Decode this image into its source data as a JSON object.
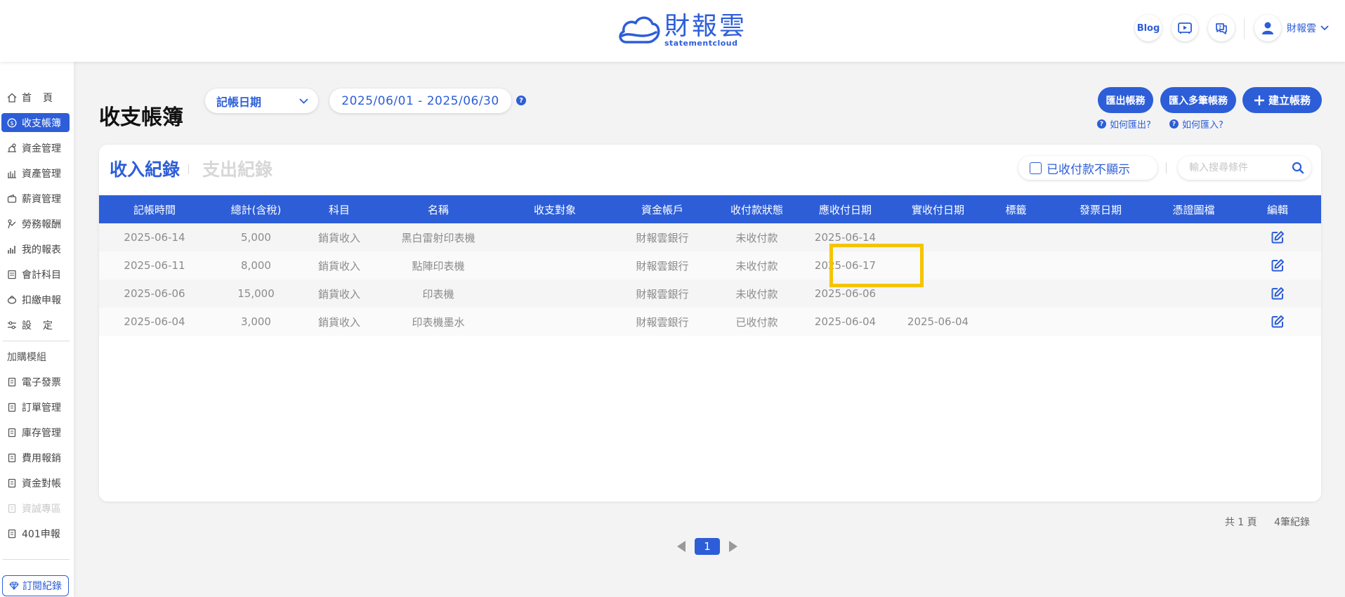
{
  "header": {
    "logo_cn": "財報雲",
    "logo_en": "statementcloud",
    "blog_label": "Blog",
    "user_name": "財報雲"
  },
  "sidebar": {
    "items": [
      {
        "label": "首頁",
        "icon": "home-icon",
        "active": false
      },
      {
        "label": "收支帳簿",
        "icon": "money-circle-icon",
        "active": true
      },
      {
        "label": "資金管理",
        "icon": "fund-icon",
        "active": false
      },
      {
        "label": "資產管理",
        "icon": "asset-icon",
        "active": false
      },
      {
        "label": "薪資管理",
        "icon": "wallet-icon",
        "active": false
      },
      {
        "label": "勞務報酬",
        "icon": "labor-icon",
        "active": false
      },
      {
        "label": "我的報表",
        "icon": "bar-chart-icon",
        "active": false
      },
      {
        "label": "會計科目",
        "icon": "ledger-icon",
        "active": false
      },
      {
        "label": "扣繳申報",
        "icon": "tax-icon",
        "active": false
      },
      {
        "label": "設定",
        "icon": "settings-sliders-icon",
        "active": false
      }
    ],
    "addon_title": "加購模組",
    "addons": [
      {
        "label": "電子發票",
        "disabled": false
      },
      {
        "label": "訂單管理",
        "disabled": false
      },
      {
        "label": "庫存管理",
        "disabled": false
      },
      {
        "label": "費用報銷",
        "disabled": false
      },
      {
        "label": "資金對帳",
        "disabled": false
      },
      {
        "label": "資誠專區",
        "disabled": true
      },
      {
        "label": "401申報",
        "disabled": false
      }
    ],
    "subscription_label": "訂閱紀錄"
  },
  "page": {
    "title": "收支帳簿",
    "date_type": "記帳日期",
    "date_range": "2025/06/01 - 2025/06/30",
    "help_glyph": "?",
    "export_label": "匯出帳務",
    "import_label": "匯入多筆帳務",
    "create_label": "建立帳務",
    "how_export": "如何匯出?",
    "how_import": "如何匯入?"
  },
  "card": {
    "tab_income": "收入紀錄",
    "tab_expense": "支出紀錄",
    "hide_paid_label": "已收付款不顯示",
    "search_placeholder": "輸入搜尋條件"
  },
  "table": {
    "columns": [
      "記帳時間",
      "總計(含稅)",
      "科目",
      "名稱",
      "收支對象",
      "資金帳戶",
      "收付款狀態",
      "應收付日期",
      "實收付日期",
      "標籤",
      "發票日期",
      "憑證圖檔",
      "編輯"
    ],
    "rows": [
      [
        "2025-06-14",
        "5,000",
        "銷貨收入",
        "黑白雷射印表機",
        "",
        "財報雲銀行",
        "未收付款",
        "2025-06-14",
        "",
        "",
        "",
        ""
      ],
      [
        "2025-06-11",
        "8,000",
        "銷貨收入",
        "點陣印表機",
        "",
        "財報雲銀行",
        "未收付款",
        "2025-06-17",
        "",
        "",
        "",
        ""
      ],
      [
        "2025-06-06",
        "15,000",
        "銷貨收入",
        "印表機",
        "",
        "財報雲銀行",
        "未收付款",
        "2025-06-06",
        "",
        "",
        "",
        ""
      ],
      [
        "2025-06-04",
        "3,000",
        "銷貨收入",
        "印表機墨水",
        "",
        "財報雲銀行",
        "已收付款",
        "2025-06-04",
        "2025-06-04",
        "",
        "",
        ""
      ]
    ]
  },
  "pagination": {
    "total_pages": "共 1 頁",
    "total_records": "4筆紀錄",
    "current_page": "1"
  },
  "colors": {
    "primary": "#2d5ed8",
    "highlight": "#f5c400"
  }
}
